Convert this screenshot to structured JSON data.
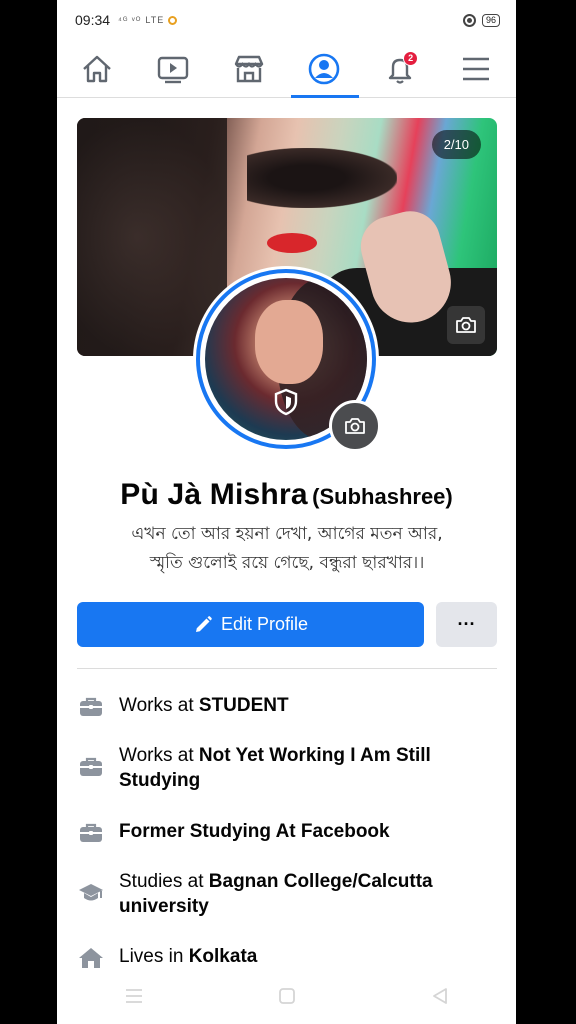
{
  "status_bar": {
    "time": "09:34",
    "signal": "⁴ᴳ ᵛᴼ",
    "volte": "LTE",
    "battery": "96"
  },
  "nav": {
    "items": [
      "home-icon",
      "video-icon",
      "marketplace-icon",
      "profile-icon",
      "notifications-icon",
      "menu-icon"
    ],
    "notification_count": "2",
    "active": "profile",
    "accent": "#1877f2"
  },
  "cover": {
    "counter": "2/10"
  },
  "profile": {
    "name": "Pù Jà Mishra",
    "alternate_name": "(Subhashree)",
    "bio_line1": "এখন তো আর হয়না দেখা, আগের মতন আর,",
    "bio_line2": "স্মৃতি গুলোই রয়ে গেছে, বন্ধুরা ছারখার।।"
  },
  "actions": {
    "edit_label": "Edit Profile",
    "more_label": "···"
  },
  "details": [
    {
      "prefix": "Works at ",
      "bold": "STUDENT",
      "icon": "briefcase-icon"
    },
    {
      "prefix": "Works at ",
      "bold": "Not Yet Working I Am Still Studying",
      "icon": "briefcase-icon"
    },
    {
      "prefix": "",
      "bold": "Former Studying At Facebook",
      "icon": "briefcase-icon"
    },
    {
      "prefix": "Studies at ",
      "bold": "Bagnan College/Calcutta university",
      "icon": "graduation-cap-icon"
    },
    {
      "prefix": "Lives in ",
      "bold": "Kolkata",
      "icon": "home-icon"
    }
  ]
}
